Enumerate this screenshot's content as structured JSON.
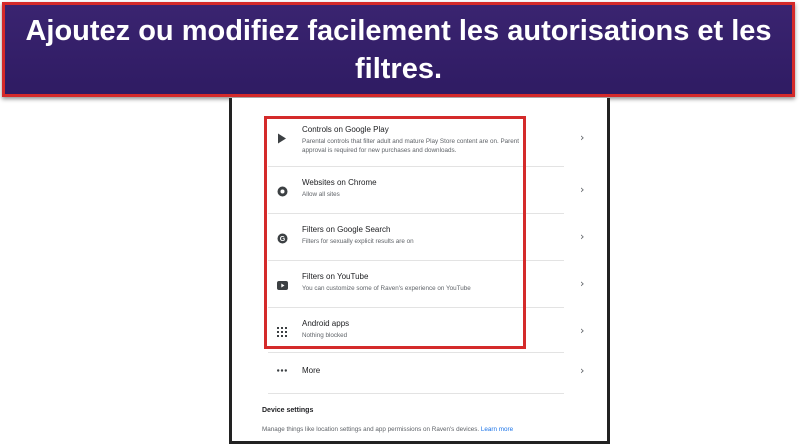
{
  "banner": {
    "title": "Ajoutez ou modifiez facilement les autorisations et les filtres."
  },
  "controls": [
    {
      "title": "Controls on Google Play",
      "subtitle": "Parental controls that filter adult and mature Play Store content are on. Parent approval is required for new purchases and downloads.",
      "icon": "google-play-icon"
    },
    {
      "title": "Websites on Chrome",
      "subtitle": "Allow all sites",
      "icon": "chrome-icon"
    },
    {
      "title": "Filters on Google Search",
      "subtitle": "Filters for sexually explicit results are on",
      "icon": "google-icon"
    },
    {
      "title": "Filters on YouTube",
      "subtitle": "You can customize some of Raven's experience on YouTube",
      "icon": "youtube-icon"
    },
    {
      "title": "Android apps",
      "subtitle": "Nothing blocked",
      "icon": "apps-grid-icon"
    },
    {
      "title": "More",
      "subtitle": "",
      "icon": "more-dots-icon"
    }
  ],
  "device_settings": {
    "title": "Device settings",
    "description": "Manage things like location settings and app permissions on Raven's devices.",
    "link": "Learn more"
  },
  "colors": {
    "banner_bg": "#3a2470",
    "highlight": "#d42a2a",
    "link": "#1a73e8"
  }
}
